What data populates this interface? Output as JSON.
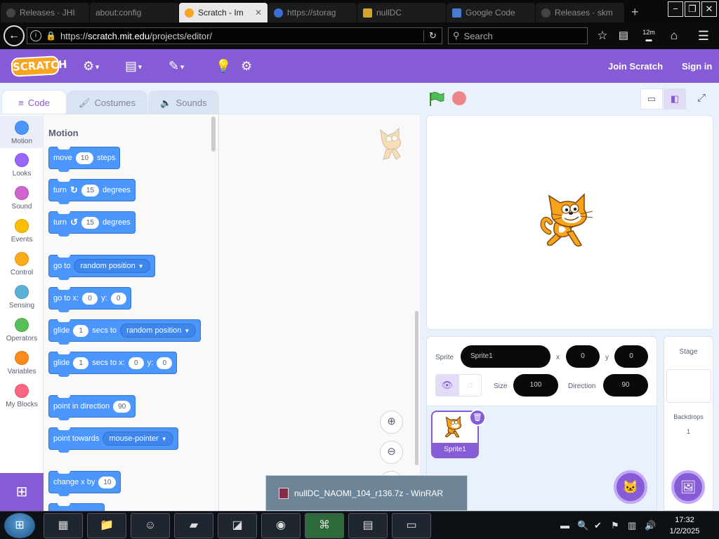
{
  "browser": {
    "tabs": [
      {
        "title": "Releases · JHI"
      },
      {
        "title": "about:config"
      },
      {
        "title": "Scratch - Im",
        "active": true
      },
      {
        "title": "https://storag"
      },
      {
        "title": "nullDC"
      },
      {
        "title": "Google Code"
      },
      {
        "title": "Releases · skm"
      }
    ],
    "url_prefix": "https://",
    "url_host": "scratch.mit.edu",
    "url_path": "/projects/editor/",
    "search_placeholder": "Search",
    "pocket_badge": "12m"
  },
  "menu": {
    "logo": "SCRATCH",
    "join": "Join Scratch",
    "signin": "Sign in"
  },
  "editor_tabs": {
    "code": "Code",
    "costumes": "Costumes",
    "sounds": "Sounds"
  },
  "categories": [
    {
      "label": "Motion",
      "color": "#4c97ff"
    },
    {
      "label": "Looks",
      "color": "#9966ff"
    },
    {
      "label": "Sound",
      "color": "#cf63cf"
    },
    {
      "label": "Events",
      "color": "#ffbf00"
    },
    {
      "label": "Control",
      "color": "#ffab19"
    },
    {
      "label": "Sensing",
      "color": "#5cb1d6"
    },
    {
      "label": "Operators",
      "color": "#59c059"
    },
    {
      "label": "Variables",
      "color": "#ff8c1a"
    },
    {
      "label": "My Blocks",
      "color": "#ff6680"
    }
  ],
  "palette": {
    "title": "Motion",
    "move": {
      "pre": "move",
      "val": "10",
      "post": "steps"
    },
    "turn_right": {
      "pre": "turn",
      "val": "15",
      "post": "degrees"
    },
    "turn_left": {
      "pre": "turn",
      "val": "15",
      "post": "degrees"
    },
    "goto": {
      "pre": "go to",
      "drop": "random position"
    },
    "goto_xy": {
      "pre": "go to x:",
      "x": "0",
      "ylabel": "y:",
      "y": "0"
    },
    "glide_to": {
      "pre": "glide",
      "val": "1",
      "mid": "secs to",
      "drop": "random position"
    },
    "glide_xy": {
      "pre": "glide",
      "val": "1",
      "mid": "secs to x:",
      "x": "0",
      "ylabel": "y:",
      "y": "0"
    },
    "point_dir": {
      "pre": "point in direction",
      "val": "90"
    },
    "point_towards": {
      "pre": "point towards",
      "drop": "mouse-pointer"
    },
    "change_x": {
      "pre": "change x by",
      "val": "10"
    }
  },
  "sprite_info": {
    "sprite_label": "Sprite",
    "sprite_name": "Sprite1",
    "x_label": "x",
    "x": "0",
    "y_label": "y",
    "y": "0",
    "size_label": "Size",
    "size": "100",
    "direction_label": "Direction",
    "direction": "90"
  },
  "sprite_tile": {
    "name": "Sprite1"
  },
  "stage_pane": {
    "title": "Stage",
    "backdrops_label": "Backdrops",
    "backdrops_count": "1"
  },
  "popup": {
    "text": "nullDC_NAOMI_104_r136.7z - WinRAR"
  },
  "taskbar": {
    "time": "17:32",
    "date": "1/2/2025"
  },
  "colors": {
    "scratch_purple": "#855cd6",
    "motion_blue": "#4c97ff",
    "cat_orange": "#f9a31b"
  }
}
